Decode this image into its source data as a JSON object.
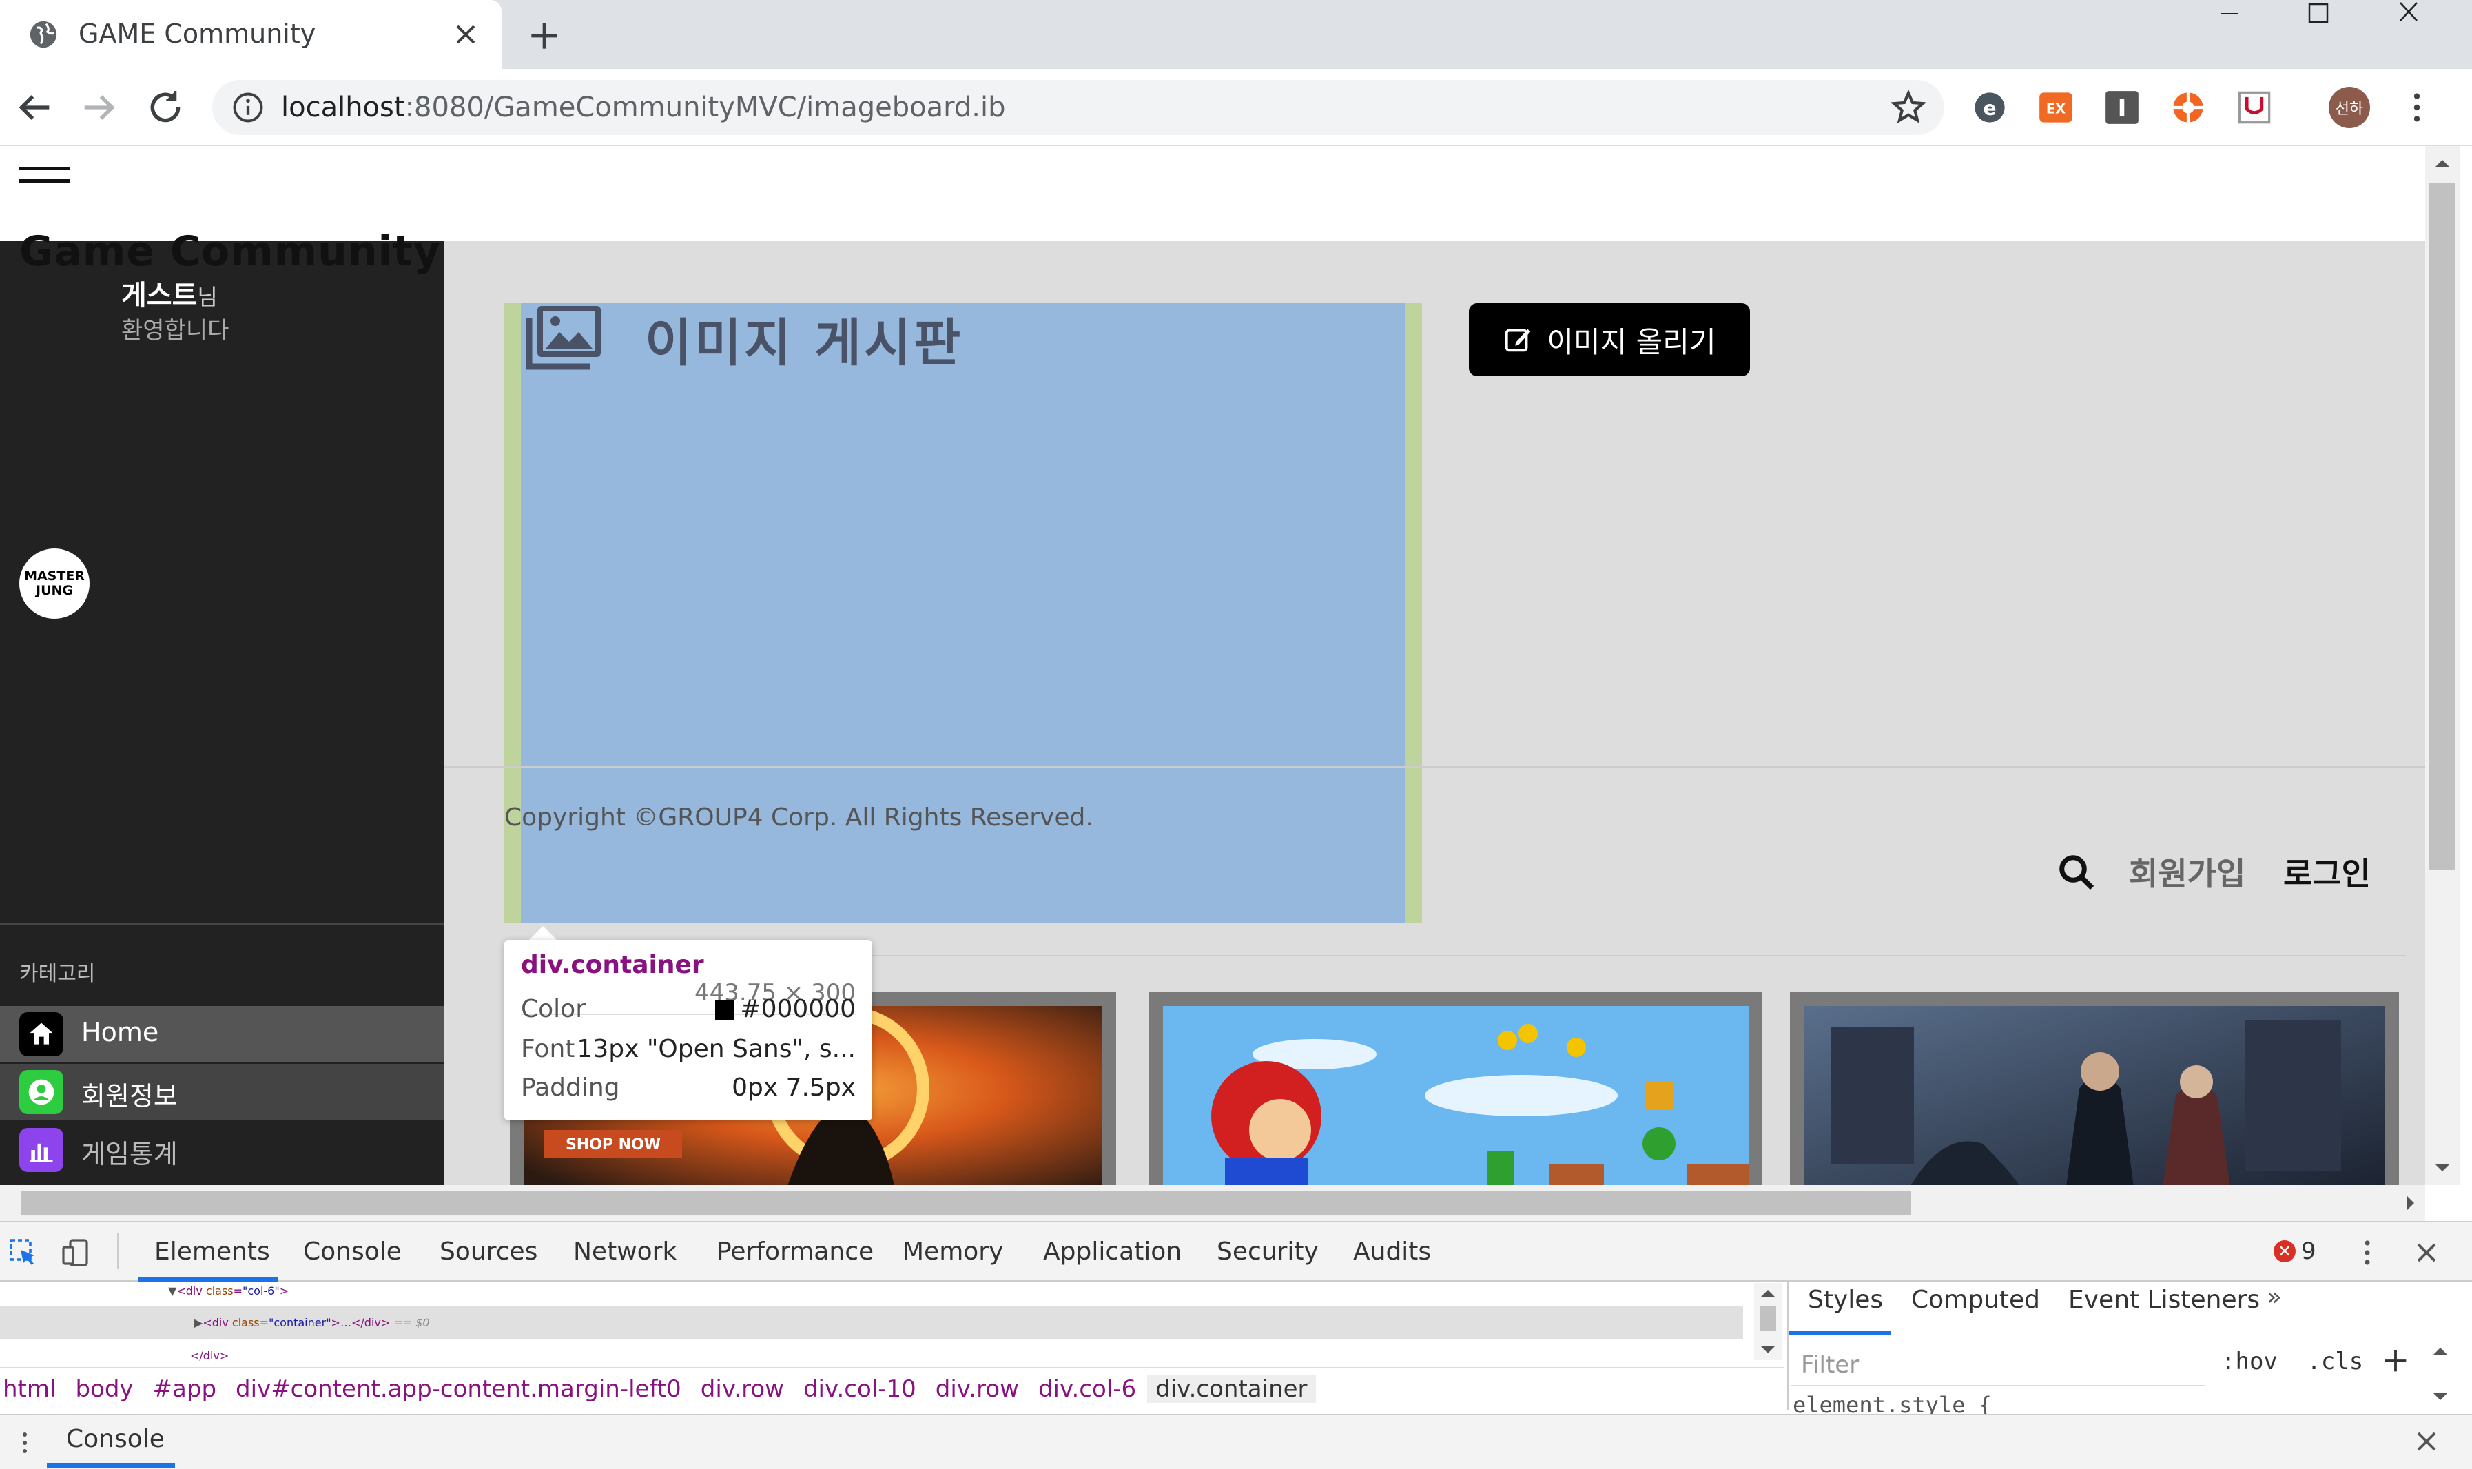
{
  "browser": {
    "tab_title": "GAME Community",
    "new_tab_symbol": "+",
    "url_host": "localhost",
    "url_rest": ":8080/GameCommunityMVC/imageboard.ib",
    "profile_initials": "선하",
    "extensions": [
      "ext-e-icon",
      "ex-icon",
      "i-icon",
      "orange-icon",
      "pocket-icon"
    ]
  },
  "site": {
    "brand": "Game Community",
    "guest_name": "게스트",
    "guest_suffix": "님",
    "welcome": "환영합니다",
    "logo_line1": "MASTER",
    "logo_line2": "JUNG",
    "category_label": "카테고리",
    "menu": [
      {
        "label": "Home",
        "icon": "home-icon",
        "color": "#000000"
      },
      {
        "label": "회원정보",
        "icon": "user-circle-icon",
        "color": "#2ecc40"
      },
      {
        "label": "게임통계",
        "icon": "bar-chart-icon",
        "color": "#8e44ec"
      }
    ],
    "board_title": "이미지 게시판",
    "upload_button": "이미지 올리기",
    "copyright": "Copyright ©GROUP4 Corp. All Rights Reserved.",
    "join": "회원가입",
    "login": "로그인",
    "shop_now": "SHOP NOW"
  },
  "tooltip": {
    "element": "div.container",
    "size": "443.75 × 300",
    "color_label": "Color",
    "color_value": "#000000",
    "font_label": "Font",
    "font_value": "13px \"Open Sans\", s...",
    "padding_label": "Padding",
    "padding_value": "0px 7.5px"
  },
  "devtools": {
    "tabs": [
      "Elements",
      "Console",
      "Sources",
      "Network",
      "Performance",
      "Memory",
      "Application",
      "Security",
      "Audits"
    ],
    "error_count": "9",
    "code": {
      "line1_tag": "div",
      "line1_attr": "class",
      "line1_val": "\"col-6\"",
      "line2_tag": "div",
      "line2_attr": "class",
      "line2_val": "\"container\"",
      "line2_tail": "…</div>",
      "line2_ref": "== $0",
      "line3": "</div>"
    },
    "breadcrumbs": [
      "html",
      "body",
      "#app",
      "div#content.app-content.margin-left0",
      "div.row",
      "div.col-10",
      "div.row",
      "div.col-6",
      "div.container"
    ],
    "styles_tabs": [
      "Styles",
      "Computed",
      "Event Listeners"
    ],
    "filter_placeholder": "Filter",
    "hov": ":hov",
    "cls": ".cls",
    "element_style": "element.style {",
    "drawer_tab": "Console"
  }
}
